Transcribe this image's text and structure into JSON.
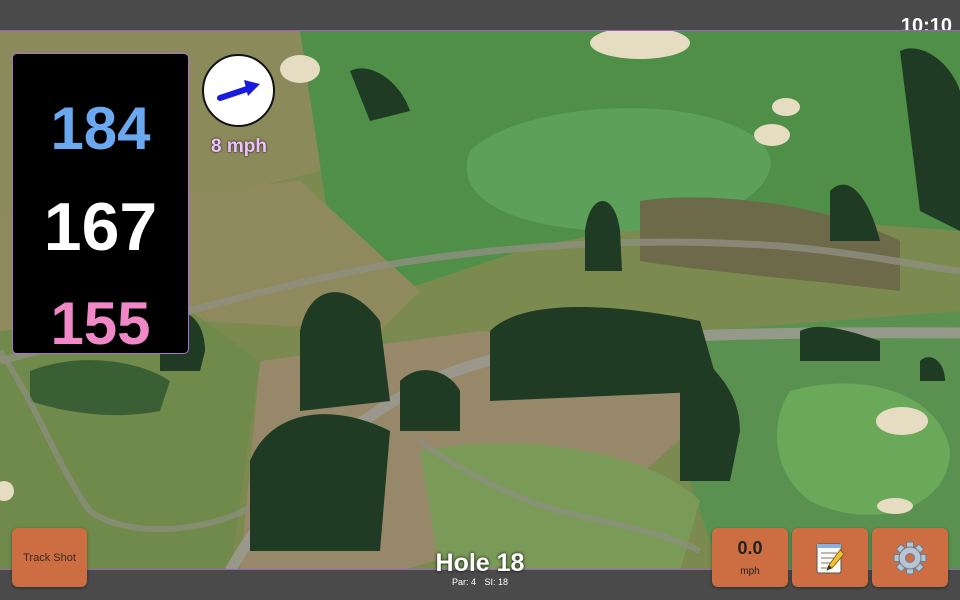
{
  "status_bar": {
    "time": "10:10"
  },
  "distances": {
    "back": "184",
    "center": "167",
    "front": "155"
  },
  "wind": {
    "speed_label": "8 mph",
    "icon": "wind-direction-arrow-icon",
    "arrow_color": "#1a1adf"
  },
  "buttons": {
    "track_shot_label": "Track Shot",
    "speed_value": "0.0",
    "speed_unit": "mph",
    "notes_icon": "notepad-icon",
    "settings_icon": "gear-icon"
  },
  "hole": {
    "title": "Hole 18",
    "par_label": "Par: 4",
    "si_label": "SI: 18"
  },
  "colors": {
    "back_distance": "#6aa8f0",
    "center_distance": "#ffffff",
    "front_distance": "#f088c8",
    "button_bg": "#cc6e42",
    "bar_bg": "#4a4a4a"
  }
}
